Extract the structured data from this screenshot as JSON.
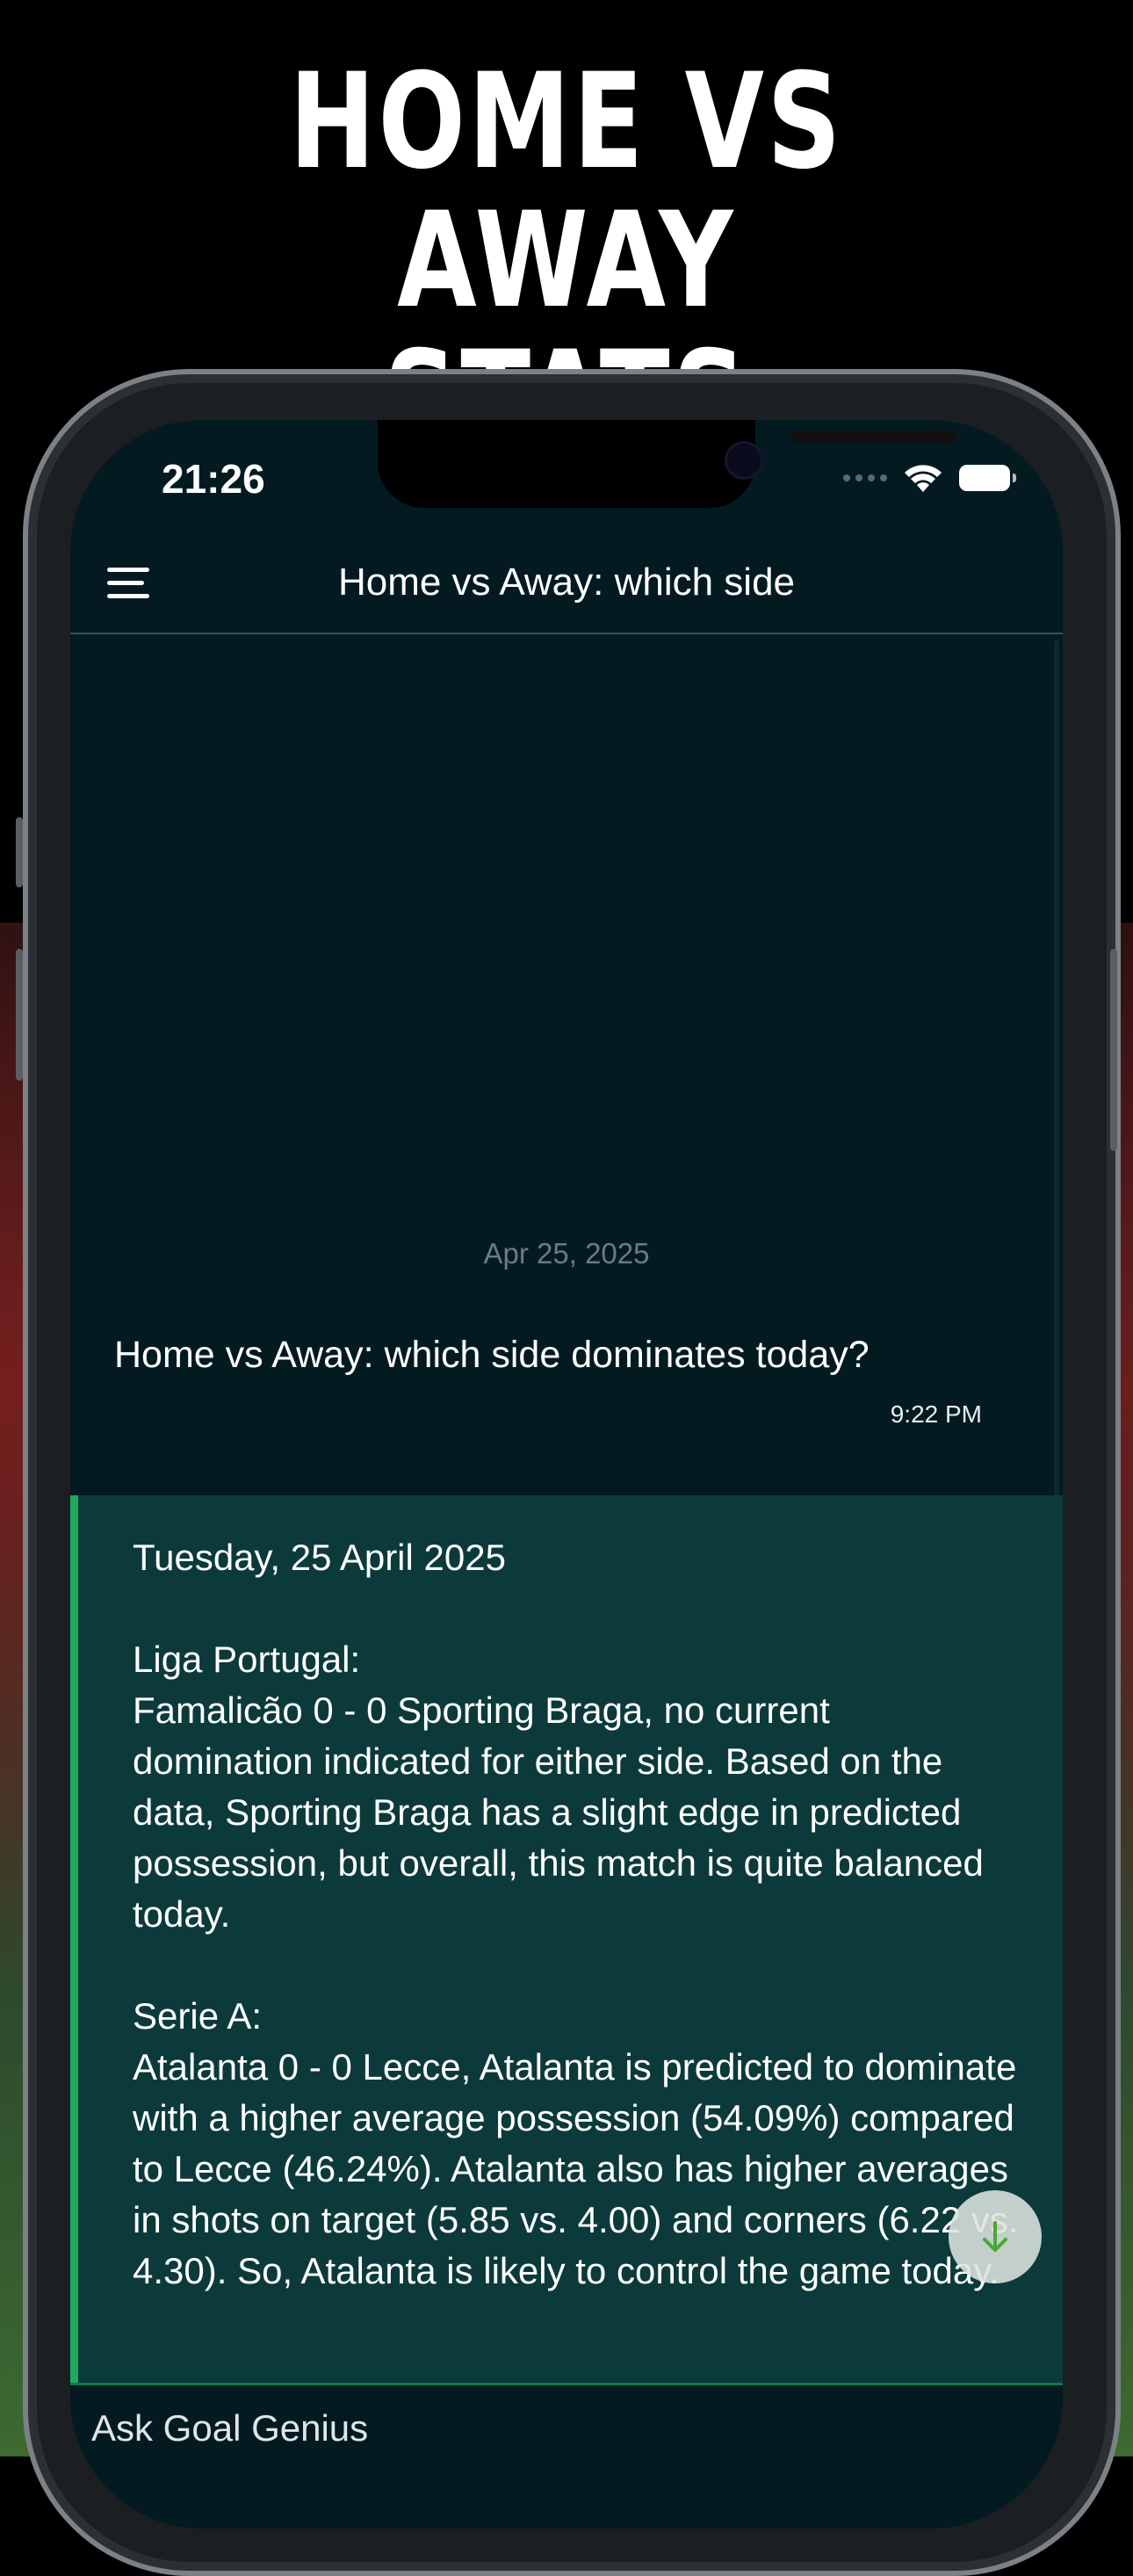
{
  "banner": {
    "line1": "HOME VS AWAY",
    "line2": "STATS"
  },
  "status_bar": {
    "time": "21:26"
  },
  "app_bar": {
    "title": "Home vs Away: which side"
  },
  "chat": {
    "date_divider": "Apr 25, 2025",
    "user_message": {
      "text": "Home vs Away: which side dominates today?",
      "time": "9:22 PM"
    },
    "bot_message": {
      "date_line": "Tuesday, 25 April 2025",
      "sections": [
        {
          "league": "Liga Portugal:",
          "body": "Famalicão 0 - 0 Sporting Braga, no current domination indicated for either side. Based on the data, Sporting Braga has a slight edge in predicted possession, but overall, this match is quite balanced today."
        },
        {
          "league": "Serie A:",
          "body": "Atalanta 0 - 0 Lecce, Atalanta is predicted to dominate with a higher average possession (54.09%) compared to Lecce (46.24%). Atalanta also has higher averages in shots on target (5.85 vs. 4.00) and corners (6.22 vs. 4.30). So, Atalanta is likely to control the game today."
        }
      ]
    }
  },
  "input": {
    "placeholder": "Ask Goal Genius"
  },
  "colors": {
    "background": "#031a21",
    "bot_bubble": "#0c3a3a",
    "accent_green": "#1faa5e"
  },
  "icons": {
    "menu": "hamburger-menu-icon",
    "scroll_down": "arrow-down-icon",
    "wifi": "wifi-icon",
    "battery": "battery-icon"
  }
}
